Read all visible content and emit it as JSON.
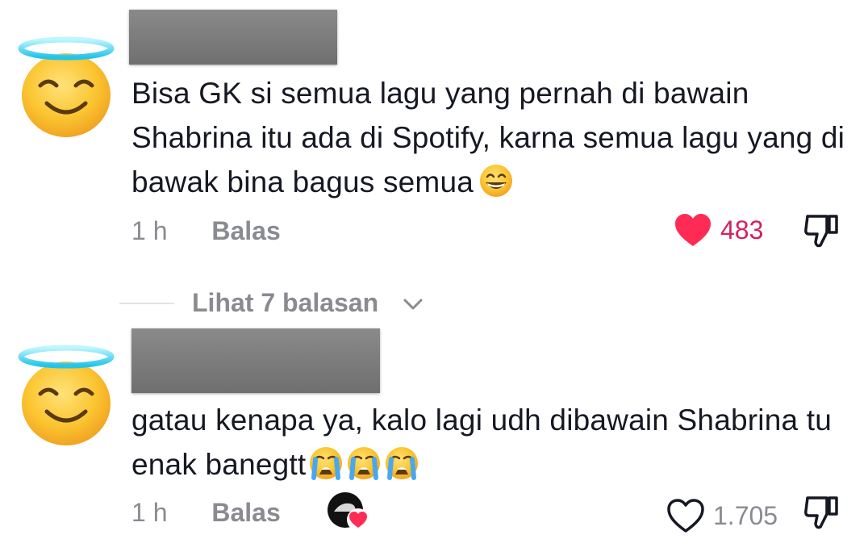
{
  "comments": [
    {
      "avatar_icon": "smiling-face-with-halo",
      "text": "Bisa GK si semua lagu yang pernah di bawain Shabrina itu ada di Spotify, karna semua lagu yang di bawak bina bagus semua",
      "trailing_emoji": [
        "grinning-face-with-smiling-eyes"
      ],
      "time": "1 h",
      "reply_label": "Balas",
      "likes": "483",
      "liked": true
    },
    {
      "avatar_icon": "smiling-face-with-halo",
      "text": "gatau kenapa ya, kalo lagi udh dibawain Shabrina tu enak banegtt",
      "trailing_emoji": [
        "loudly-crying-face",
        "loudly-crying-face",
        "loudly-crying-face"
      ],
      "time": "1 h",
      "reply_label": "Balas",
      "likes": "1.705",
      "liked": false,
      "creator_liked": true
    }
  ],
  "view_replies_label": "Lihat 7 balasan",
  "colors": {
    "liked_red": "#fe2c55",
    "like_count_red": "#d0245e",
    "meta_gray": "#8a8b91",
    "text": "#161823"
  }
}
